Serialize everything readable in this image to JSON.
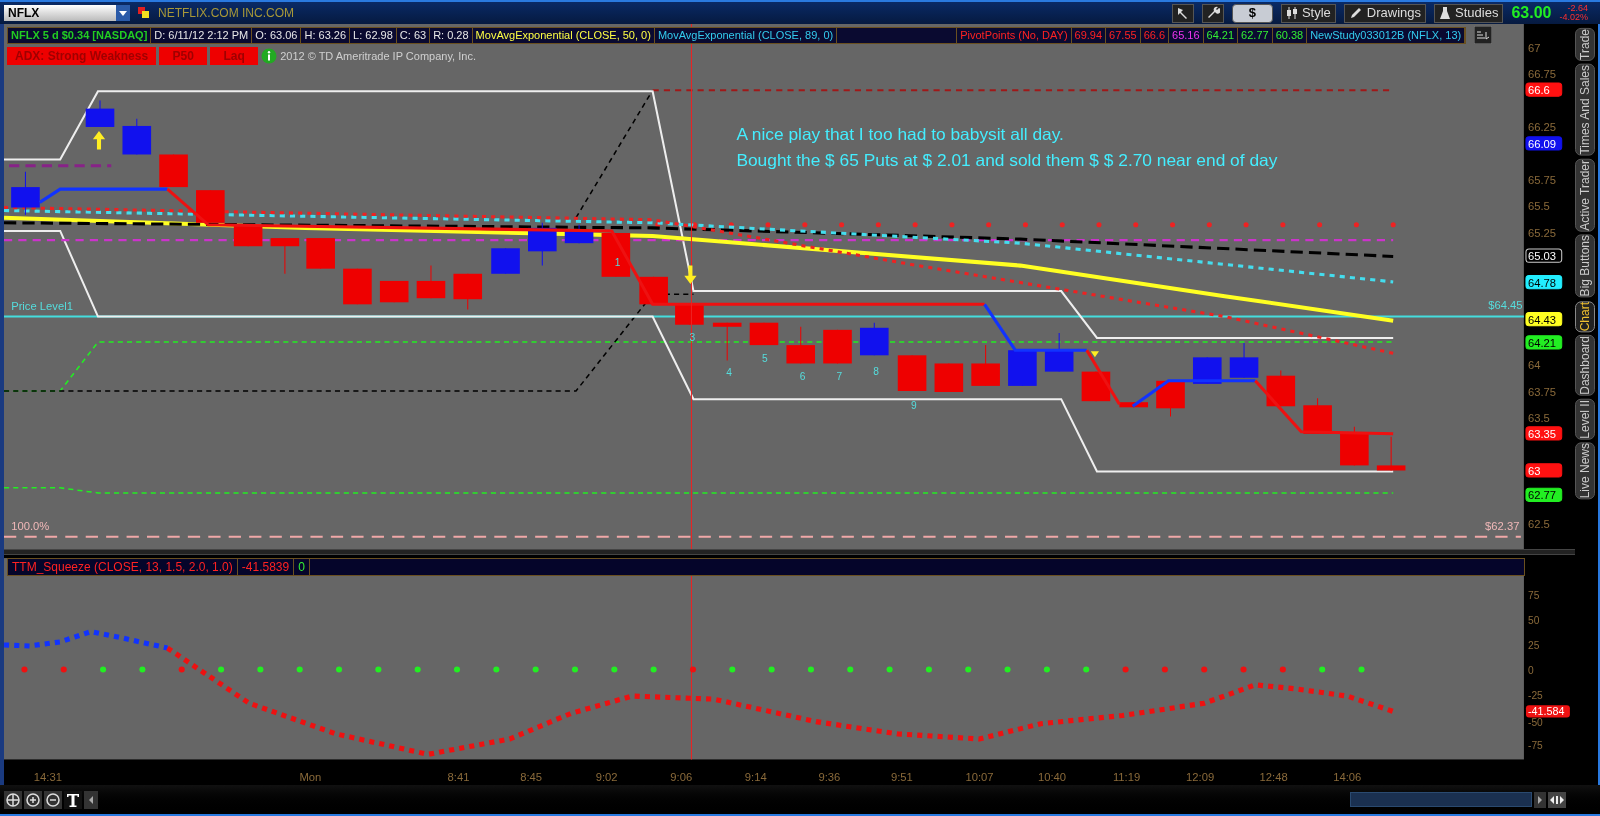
{
  "symbol_bar": {
    "symbol": "NFLX",
    "company": "NETFLIX.COM INC.COM",
    "buttons": [
      {
        "kind": "icon"
      },
      {
        "kind": "icon"
      },
      {
        "kind": "plain",
        "label": "$"
      },
      {
        "kind": "text",
        "label": "Style"
      },
      {
        "kind": "text",
        "label": "Drawings"
      },
      {
        "kind": "text",
        "label": "Studies"
      }
    ],
    "last": "63.00",
    "change": "-2.64",
    "change_pct": "-4.02%"
  },
  "studies": [
    "NFLX 5 d $0.34 [NASDAQ]",
    "D: 6/11/12 2:12 PM",
    "O: 63.06",
    "H: 63.26",
    "L: 62.98",
    "C: 63",
    "R: 0.28",
    "MovAvgExponential (CLOSE, 50, 0)",
    "MovAvgExponential (CLOSE, 89, 0)",
    "PivotPoints (No, DAY)",
    "69.94",
    "67.55",
    "66.6",
    "65.16",
    "64.21",
    "62.77",
    "60.38",
    "NewStudy033012B (NFLX, 13)"
  ],
  "signals": [
    "ADX:  Strong Weakness",
    "P50",
    "Laq"
  ],
  "copyright": "2012 © TD Ameritrade IP Company, Inc.",
  "price_pane": {
    "y_ticks": [
      "67",
      "66.75",
      "66.25",
      "65.75",
      "65.5",
      "65.25",
      "64",
      "63.75",
      "63.5",
      "62.5"
    ],
    "badges": [
      "66.6",
      "66.09",
      "65.03",
      "64.78",
      "64.43",
      "64.21",
      "63.35",
      "63",
      "62.77"
    ],
    "price_level_label": "Price Level1",
    "price_level_value": "$64.45",
    "fib_label": "100.0%",
    "fib_value": "$62.37",
    "annotation": [
      "A nice play that I too had to babysit all day.",
      "Bought the $ 65 Puts at $ 2.01 and sold them $ $ 2.70 near end of day"
    ],
    "counts": [
      "1",
      "3",
      "4",
      "5",
      "6",
      "7",
      "8",
      "9"
    ]
  },
  "squeeze_pane": {
    "header": [
      "TTM_Squeeze (CLOSE, 13, 1.5, 2.0, 1.0)",
      "-41.5839",
      "0"
    ],
    "y_ticks": [
      "75",
      "50",
      "25",
      "0",
      "-25",
      "-50",
      "-75"
    ],
    "badge": "-41.584"
  },
  "x_ticks": [
    "14:31",
    "Mon",
    "8:41",
    "8:45",
    "9:02",
    "9:06",
    "9:14",
    "9:36",
    "9:51",
    "10:07",
    "10:40",
    "11:19",
    "12:09",
    "12:48",
    "14:06"
  ],
  "side_tabs": [
    {
      "label": "Trade",
      "selected": false
    },
    {
      "label": "Times And Sales",
      "selected": false
    },
    {
      "label": "Active Trader",
      "selected": false
    },
    {
      "label": "Big Buttons",
      "selected": false
    },
    {
      "label": "Chart",
      "selected": true
    },
    {
      "label": "Dashboard",
      "selected": false
    },
    {
      "label": "Level II",
      "selected": false
    },
    {
      "label": "Live News",
      "selected": false
    }
  ]
}
